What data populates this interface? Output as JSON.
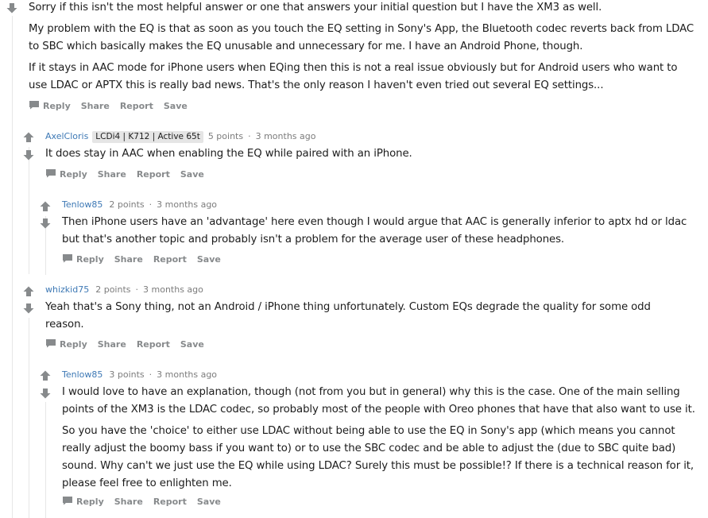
{
  "comments": [
    {
      "author": "",
      "paragraphs": [
        "Sorry if this isn't the most helpful answer or one that answers your initial question but I have the XM3 as well.",
        "My problem with the EQ is that as soon as you touch the EQ setting in Sony's App, the Bluetooth codec reverts back from LDAC to SBC which basically makes the EQ unusable and unnecessary for me. I have an Android Phone, though.",
        "If it stays in AAC mode for iPhone users when EQing then this is not a real issue obviously but for Android users who want to use LDAC or APTX this is really bad news. That's the only reason I haven't even tried out several EQ settings..."
      ]
    },
    {
      "author": "AxelCloris",
      "flair": "LCDi4 | K712 | Active 65t",
      "points": "5 points",
      "time": "3 months ago",
      "paragraphs": [
        "It does stay in AAC when enabling the EQ while paired with an iPhone."
      ]
    },
    {
      "author": "Tenlow85",
      "points": "2 points",
      "time": "3 months ago",
      "paragraphs": [
        "Then iPhone users have an 'advantage' here even though I would argue that AAC is generally inferior to aptx hd or ldac but that's another topic and probably isn't a problem for the average user of these headphones."
      ]
    },
    {
      "author": "whizkid75",
      "points": "2 points",
      "time": "3 months ago",
      "paragraphs": [
        "Yeah that's a Sony thing, not an Android / iPhone thing unfortunately. Custom EQs degrade the quality for some odd reason."
      ]
    },
    {
      "author": "Tenlow85",
      "points": "3 points",
      "time": "3 months ago",
      "paragraphs": [
        "I would love to have an explanation, though (not from you but in general) why this is the case. One of the main selling points of the XM3 is the LDAC codec, so probably most of the people with Oreo phones that have that also want to use it.",
        "So you have the 'choice' to either use LDAC without being able to use the EQ in Sony's app (which means you cannot really adjust the boomy bass if you want to) or to use the SBC codec and be able to adjust the (due to SBC quite bad) sound. Why can't we just use the EQ while using LDAC? Surely this must be possible!? If there is a technical reason for it, please feel free to enlighten me."
      ]
    }
  ],
  "actions": {
    "reply": "Reply",
    "share": "Share",
    "report": "Report",
    "save": "Save"
  },
  "icons": {
    "upvote": "upvote-arrow-icon",
    "downvote": "downvote-arrow-icon",
    "comment": "comment-bubble-icon"
  },
  "colors": {
    "author": "#3e79b5",
    "meta": "#7c7c7c",
    "action": "#878a8c",
    "thread_line": "#e6e6e6",
    "arrow": "#878a8c",
    "flair_bg": "#e5e5e5"
  }
}
